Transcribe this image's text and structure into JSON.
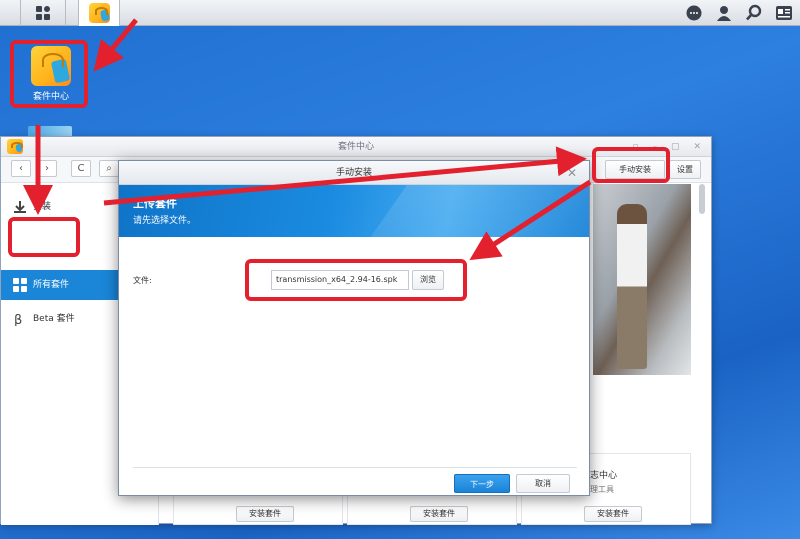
{
  "desktop": {
    "package_center_label": "套件中心"
  },
  "main_window": {
    "title": "套件中心",
    "toolbar": {
      "back": "‹",
      "forward": "›",
      "refresh": "C",
      "search": "⌕",
      "manual_install": "手动安装",
      "settings": "设置"
    },
    "sidebar": {
      "items": [
        {
          "label": "安装"
        },
        {
          "label": "所有套件"
        },
        {
          "label": "Beta 套件"
        }
      ]
    },
    "cards": [
      {
        "install_label": "安装套件"
      },
      {
        "install_label": "安装套件"
      },
      {
        "install_label": "安装套件",
        "title": "志中心",
        "subtitle": "理工具"
      }
    ]
  },
  "dialog": {
    "title": "手动安装",
    "banner_title": "上传套件",
    "banner_subtitle": "请先选择文件。",
    "file_label": "文件:",
    "file_value": "transmission_x64_2.94-16.spk",
    "browse": "浏览",
    "next": "下一步",
    "cancel": "取消"
  },
  "colors": {
    "accent": "#1b86d8",
    "highlight": "#e2202e"
  }
}
